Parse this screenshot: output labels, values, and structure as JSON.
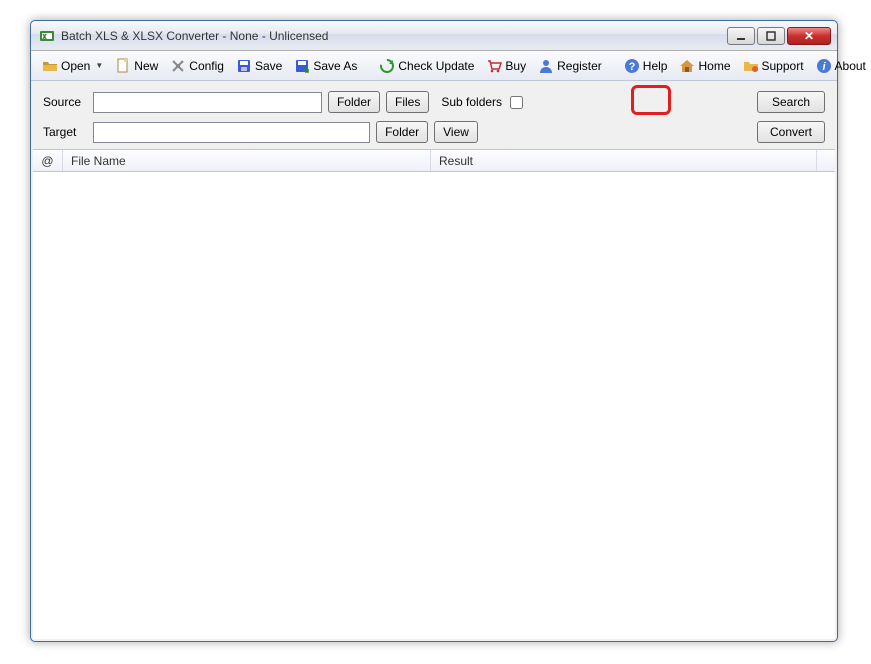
{
  "window": {
    "title": "Batch XLS & XLSX Converter - None - Unlicensed"
  },
  "toolbar": {
    "open": "Open",
    "new": "New",
    "config": "Config",
    "save": "Save",
    "saveAs": "Save As",
    "checkUpdate": "Check Update",
    "buy": "Buy",
    "register": "Register",
    "help": "Help",
    "home": "Home",
    "support": "Support",
    "about": "About"
  },
  "form": {
    "sourceLabel": "Source",
    "sourceValue": "",
    "targetLabel": "Target",
    "targetValue": "",
    "folderBtn": "Folder",
    "filesBtn": "Files",
    "viewBtn": "View",
    "subFoldersLabel": "Sub folders",
    "subFoldersChecked": false,
    "searchBtn": "Search",
    "convertBtn": "Convert"
  },
  "list": {
    "cols": {
      "at": "@",
      "fileName": "File Name",
      "result": "Result"
    },
    "rows": []
  }
}
